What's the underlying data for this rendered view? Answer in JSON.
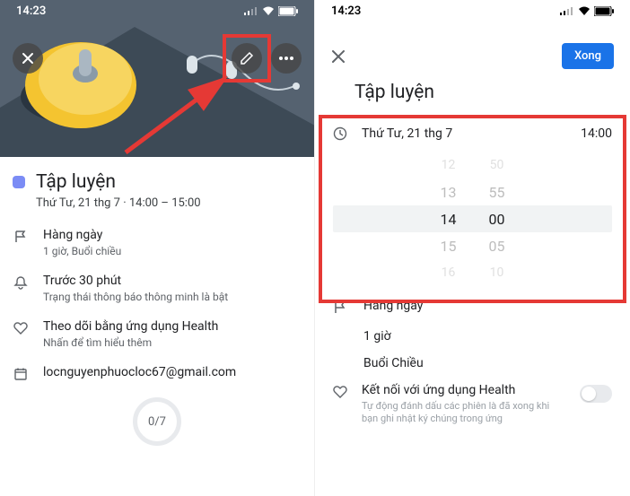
{
  "status": {
    "time": "14:23"
  },
  "left": {
    "title": "Tập luyện",
    "subtitle": "Thứ Tư, 21 thg 7 · 14:00 – 15:00",
    "repeat": {
      "label": "Hàng ngày",
      "sub": "1 giờ, Buổi chiều"
    },
    "reminder": {
      "label": "Trước 30 phút",
      "sub": "Trạng thái thông báo thông minh là bật"
    },
    "health": {
      "label": "Theo dõi bằng ứng dụng Health",
      "sub": "Nhấn để tìm hiểu thêm"
    },
    "account": "locnguyenphuocloc67@gmail.com",
    "progress": "0/7"
  },
  "right": {
    "done": "Xong",
    "title": "Tập luyện",
    "date": "Thứ Tư, 21 thg 7",
    "time": "14:00",
    "picker": {
      "r0": {
        "h": "12",
        "m": "50"
      },
      "r1": {
        "h": "13",
        "m": "55"
      },
      "sel": {
        "h": "14",
        "m": "00"
      },
      "r3": {
        "h": "15",
        "m": "05"
      },
      "r4": {
        "h": "16",
        "m": "10"
      }
    },
    "repeat": "Hàng ngày",
    "duration": "1 giờ",
    "period": "Buổi Chiều",
    "health": {
      "title": "Kết nối với ứng dụng Health",
      "sub": "Tự động đánh dấu các phiên là đã xong khi bạn ghi nhật ký chúng trong ứng"
    }
  }
}
